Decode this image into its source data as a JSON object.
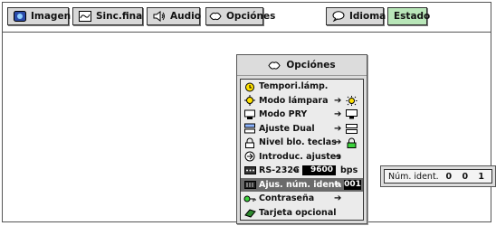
{
  "tabs": [
    {
      "label": "Imagen",
      "icon": "picture-icon"
    },
    {
      "label": "Sinc.fina",
      "icon": "fine-sync-icon"
    },
    {
      "label": "Audio",
      "icon": "speaker-icon"
    },
    {
      "label": "Opciónes",
      "icon": "options-icon"
    },
    {
      "label": "Idioma",
      "icon": "speech-bubble-icon"
    },
    {
      "label": "Estado",
      "icon": ""
    }
  ],
  "menu": {
    "title": "Opciónes",
    "items": [
      {
        "label": "Tempori.lámp.",
        "icon": "lamp-timer-icon",
        "arrow": "",
        "value": ""
      },
      {
        "label": "Modo lámpara",
        "icon": "lamp-mode-icon",
        "arrow": "➔",
        "value": ""
      },
      {
        "label": "Modo PRY",
        "icon": "projection-mode-icon",
        "arrow": "➔",
        "value": ""
      },
      {
        "label": "Ajuste Dual",
        "icon": "dual-setting-icon",
        "arrow": "➔",
        "value": ""
      },
      {
        "label": "Nivel blo. teclas",
        "icon": "key-lock-icon",
        "arrow": "➔",
        "value": ""
      },
      {
        "label": "Introduc. ajustes",
        "icon": "setting-input-icon",
        "arrow": "➔",
        "value": ""
      },
      {
        "label": "RS-232C",
        "icon": "rs232c-icon",
        "arrow": "➔",
        "value": "9600",
        "unit": "bps"
      },
      {
        "label": "Ajus. núm. ident.",
        "icon": "id-number-icon",
        "arrow": "➔",
        "value": "001"
      },
      {
        "label": "Contraseña",
        "icon": "password-key-icon",
        "arrow": "➔",
        "value": ""
      },
      {
        "label": "Tarjeta opcional",
        "icon": "option-card-icon",
        "arrow": "",
        "value": ""
      }
    ],
    "selected_index": 7
  },
  "submenu": {
    "label": "Núm. ident.",
    "value": "0 0 1"
  },
  "colors": {
    "active_tab": "#b8e6b8",
    "selected_row": "#6b6b6b",
    "menu_bg": "#dcdcdc"
  }
}
